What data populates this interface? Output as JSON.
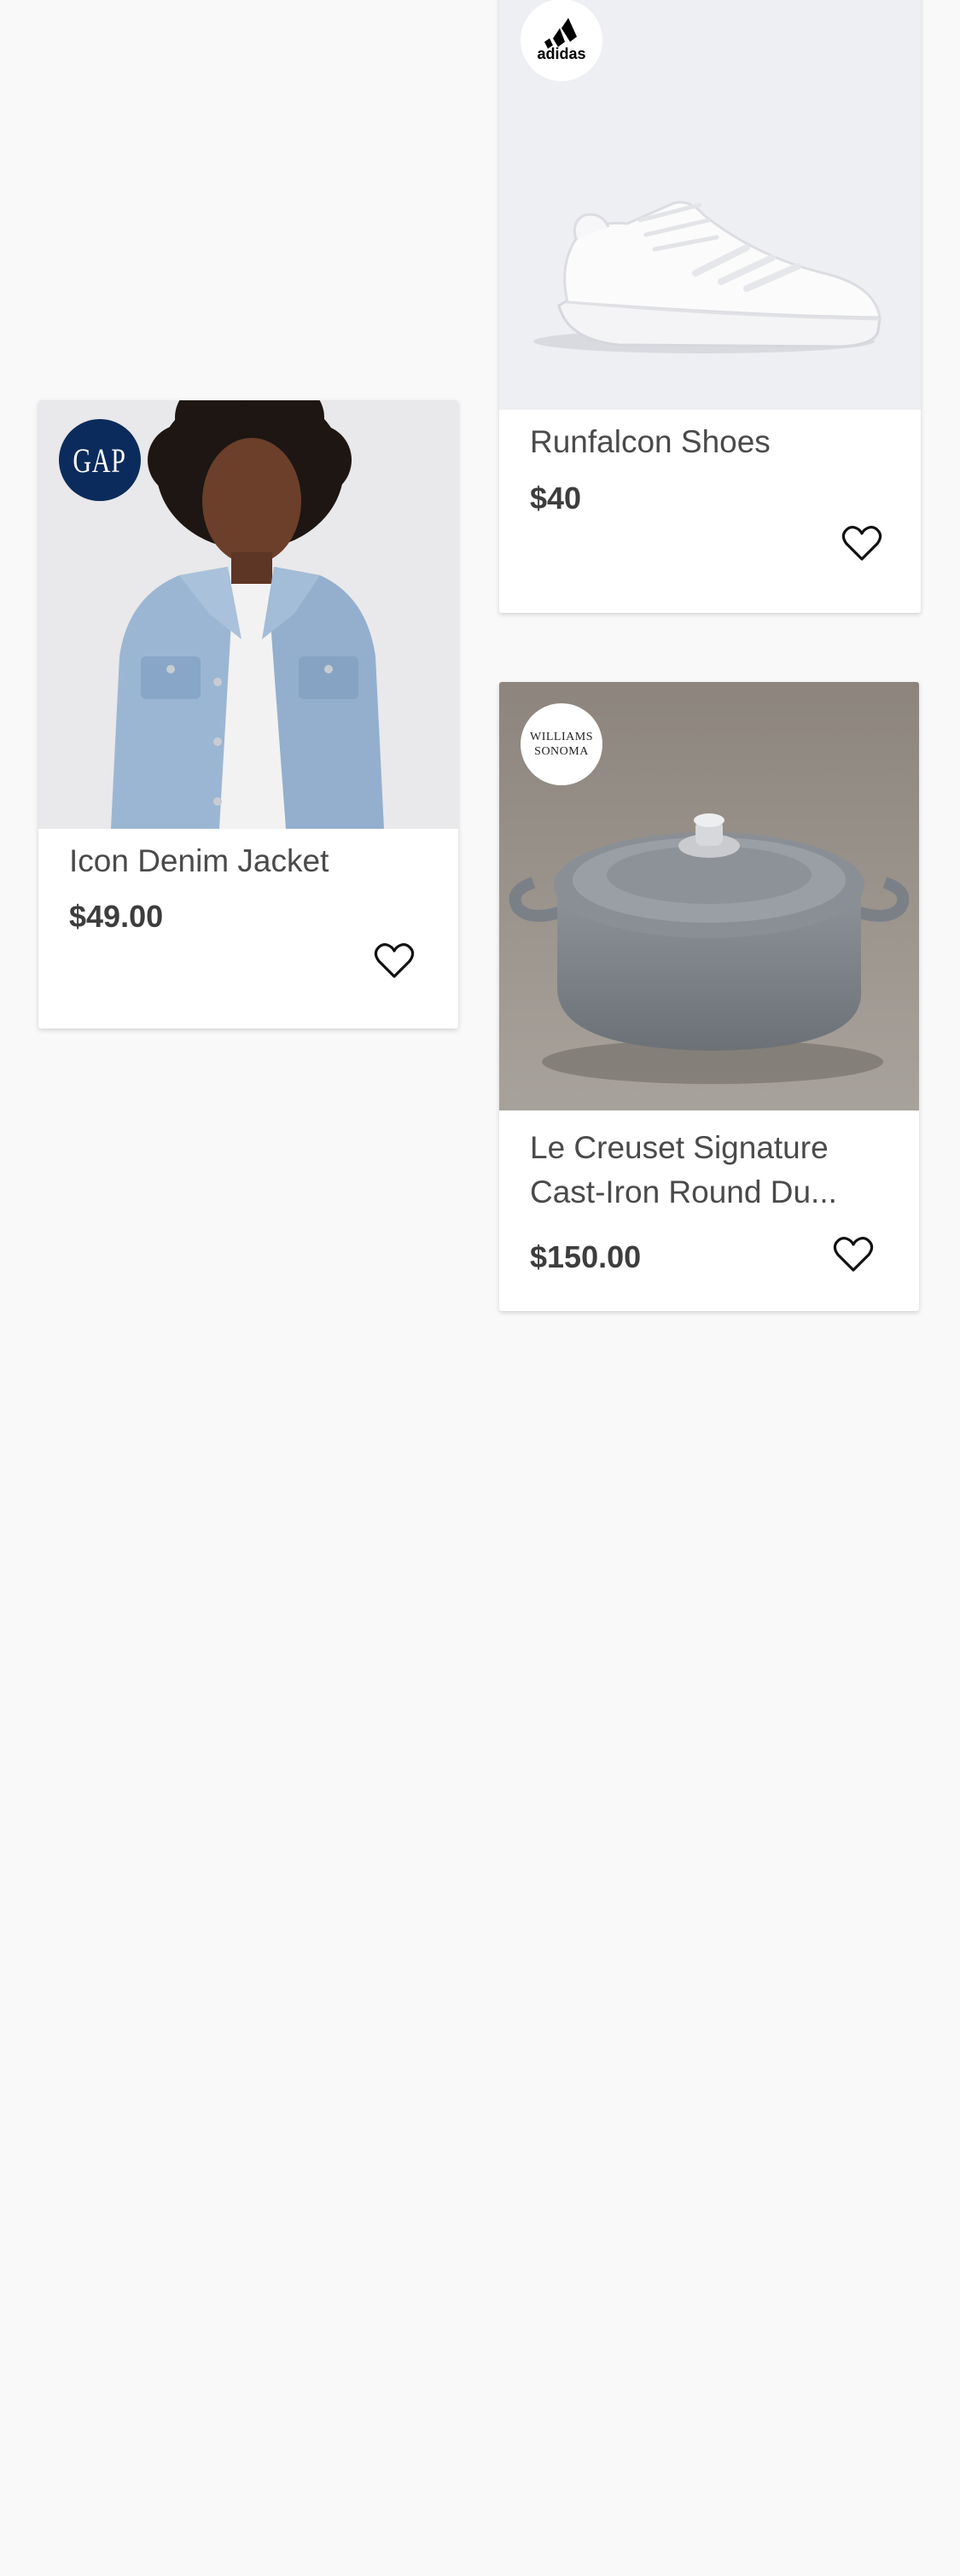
{
  "products": [
    {
      "brand": "adidas",
      "name": "Runfalcon Shoes",
      "price": "$40",
      "image": "white-running-shoe"
    },
    {
      "brand": "GAP",
      "name": "Icon Denim Jacket",
      "price": "$49.00",
      "image": "denim-jacket-model"
    },
    {
      "brand": "WILLIAMS SONOMA",
      "brand_lines": [
        "WILLIAMS",
        "SONOMA"
      ],
      "name_lines": [
        "Le Creuset Signature",
        "Cast-Iron Round Du..."
      ],
      "price": "$150.00",
      "image": "gray-dutch-oven"
    }
  ],
  "icons": {
    "favorite": "heart-outline-icon"
  },
  "colors": {
    "background": "#f9f9f9",
    "card": "#ffffff",
    "gap_navy": "#0b2b5c",
    "text": "#4a4a4a",
    "price": "#3d3d3d"
  }
}
